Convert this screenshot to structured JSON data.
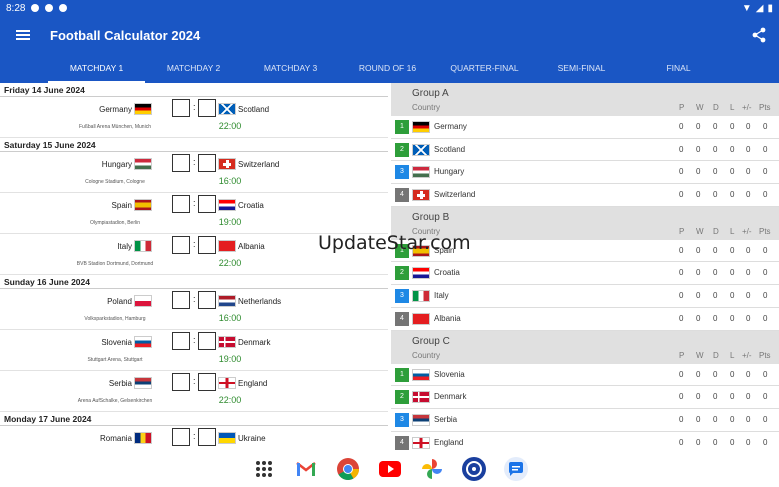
{
  "status": {
    "time": "8:28"
  },
  "app": {
    "title": "Football Calculator 2024"
  },
  "tabs": [
    "MATCHDAY 1",
    "MATCHDAY 2",
    "MATCHDAY 3",
    "ROUND OF 16",
    "QUARTER-FINAL",
    "SEMI-FINAL",
    "FINAL"
  ],
  "active_tab": 0,
  "matchdays": [
    {
      "date": "Friday 14 June 2024",
      "matches": [
        {
          "home": "Germany",
          "away": "Scotland",
          "venue": "Fußball Arena München, Munich",
          "time": "22:00"
        }
      ]
    },
    {
      "date": "Saturday 15 June 2024",
      "matches": [
        {
          "home": "Hungary",
          "away": "Switzerland",
          "venue": "Cologne Stadium, Cologne",
          "time": "16:00"
        },
        {
          "home": "Spain",
          "away": "Croatia",
          "venue": "Olympiastadion, Berlin",
          "time": "19:00"
        },
        {
          "home": "Italy",
          "away": "Albania",
          "venue": "BVB Stadion Dortmund, Dortmund",
          "time": "22:00"
        }
      ]
    },
    {
      "date": "Sunday 16 June 2024",
      "matches": [
        {
          "home": "Poland",
          "away": "Netherlands",
          "venue": "Volksparkstadion, Hamburg",
          "time": "16:00"
        },
        {
          "home": "Slovenia",
          "away": "Denmark",
          "venue": "Stuttgart Arena, Stuttgart",
          "time": "19:00"
        },
        {
          "home": "Serbia",
          "away": "England",
          "venue": "Arena AufSchalke, Gelsenkirchen",
          "time": "22:00"
        }
      ]
    },
    {
      "date": "Monday 17 June 2024",
      "matches": [
        {
          "home": "Romania",
          "away": "Ukraine",
          "venue": "",
          "time": ""
        }
      ]
    }
  ],
  "standings": {
    "columns": [
      "P",
      "W",
      "D",
      "L",
      "+/-",
      "Pts"
    ],
    "country_label": "Country",
    "groups": [
      {
        "name": "Group A",
        "teams": [
          {
            "pos": "1",
            "name": "Germany",
            "stats": [
              "0",
              "0",
              "0",
              "0",
              "0",
              "0"
            ]
          },
          {
            "pos": "2",
            "name": "Scotland",
            "stats": [
              "0",
              "0",
              "0",
              "0",
              "0",
              "0"
            ]
          },
          {
            "pos": "3",
            "name": "Hungary",
            "stats": [
              "0",
              "0",
              "0",
              "0",
              "0",
              "0"
            ]
          },
          {
            "pos": "4",
            "name": "Switzerland",
            "stats": [
              "0",
              "0",
              "0",
              "0",
              "0",
              "0"
            ]
          }
        ]
      },
      {
        "name": "Group B",
        "teams": [
          {
            "pos": "1",
            "name": "Spain",
            "stats": [
              "0",
              "0",
              "0",
              "0",
              "0",
              "0"
            ]
          },
          {
            "pos": "2",
            "name": "Croatia",
            "stats": [
              "0",
              "0",
              "0",
              "0",
              "0",
              "0"
            ]
          },
          {
            "pos": "3",
            "name": "Italy",
            "stats": [
              "0",
              "0",
              "0",
              "0",
              "0",
              "0"
            ]
          },
          {
            "pos": "4",
            "name": "Albania",
            "stats": [
              "0",
              "0",
              "0",
              "0",
              "0",
              "0"
            ]
          }
        ]
      },
      {
        "name": "Group C",
        "teams": [
          {
            "pos": "1",
            "name": "Slovenia",
            "stats": [
              "0",
              "0",
              "0",
              "0",
              "0",
              "0"
            ]
          },
          {
            "pos": "2",
            "name": "Denmark",
            "stats": [
              "0",
              "0",
              "0",
              "0",
              "0",
              "0"
            ]
          },
          {
            "pos": "3",
            "name": "Serbia",
            "stats": [
              "0",
              "0",
              "0",
              "0",
              "0",
              "0"
            ]
          },
          {
            "pos": "4",
            "name": "England",
            "stats": [
              "0",
              "0",
              "0",
              "0",
              "0",
              "0"
            ]
          }
        ]
      }
    ],
    "position_colors": {
      "1": "#2e9e3a",
      "2": "#2e9e3a",
      "3": "#1e88e5",
      "4": "#757575"
    }
  },
  "watermark": "UpdateStar.com",
  "colors": {
    "primary": "#1a56c4",
    "time_green": "#2e8b2e"
  },
  "dock": [
    "apps-grid-icon",
    "gmail-icon",
    "chrome-icon",
    "youtube-icon",
    "photos-icon",
    "settings-app-icon",
    "messages-icon"
  ]
}
